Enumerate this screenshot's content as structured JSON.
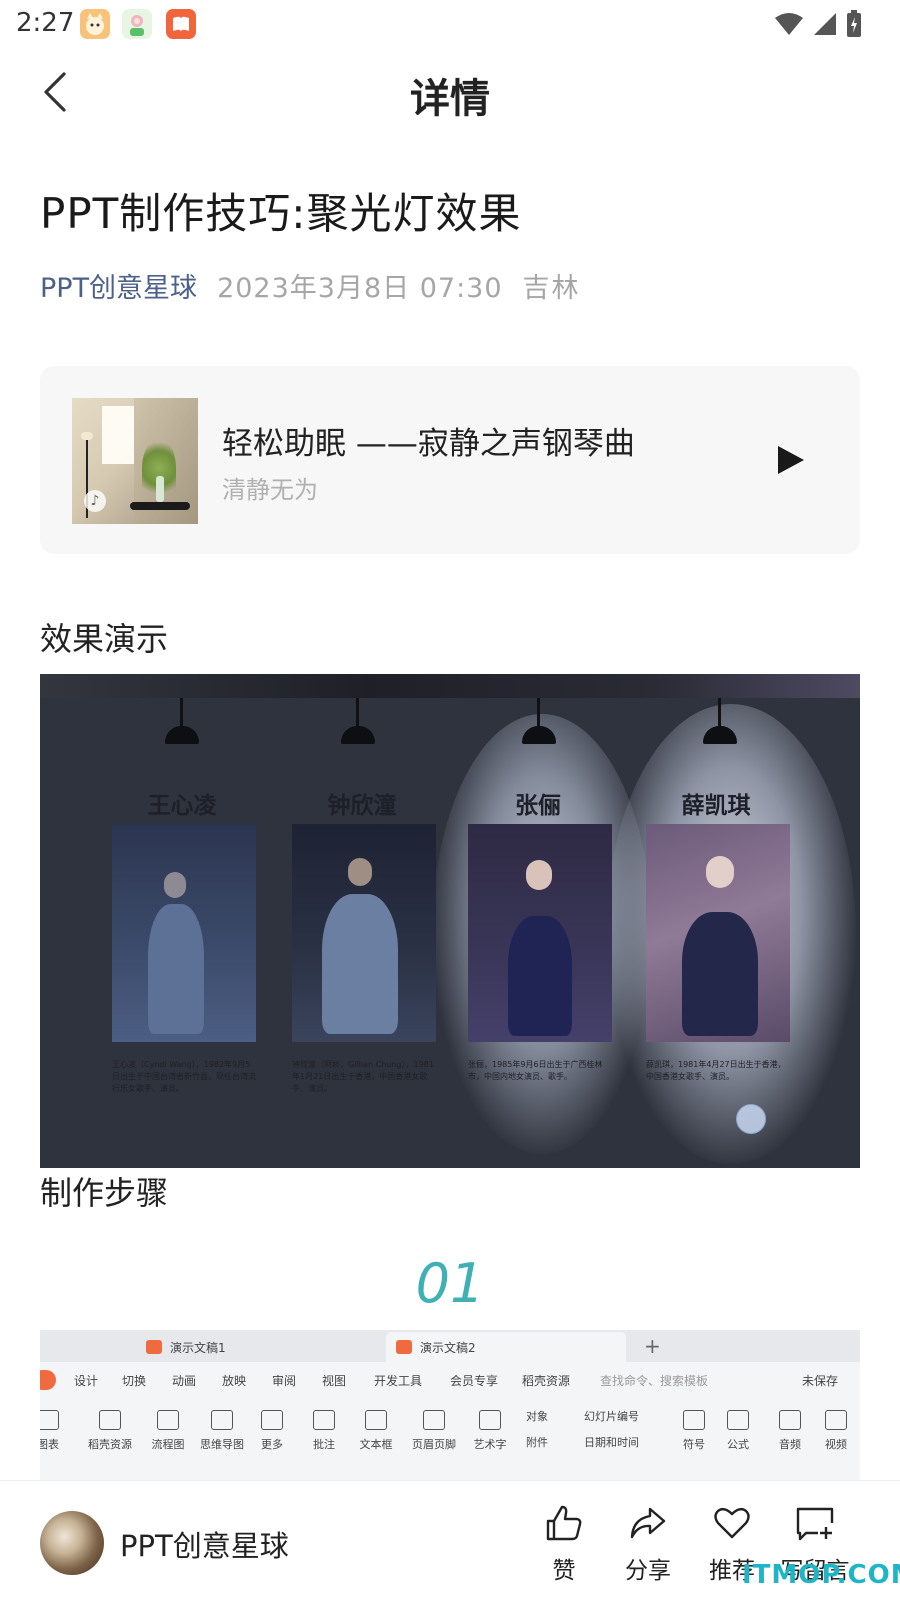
{
  "status_bar": {
    "time": "2:27"
  },
  "nav": {
    "title": "详情"
  },
  "article": {
    "title": "PPT制作技巧:聚光灯效果",
    "author": "PPT创意星球",
    "date": "2023年3月8日 07:30",
    "location": "吉林"
  },
  "music": {
    "title": "轻松助眠 ——寂静之声钢琴曲",
    "artist": "清静无为"
  },
  "sections": {
    "demo": "效果演示",
    "steps": "制作步骤"
  },
  "demo": {
    "people": [
      {
        "name": "王心凌",
        "caption": "王心凌（Cyndi Wang），1982年9月5日出生于中国台湾省新竹县，现任台湾流行乐女歌手、演员。"
      },
      {
        "name": "钟欣潼",
        "caption": "钟欣潼（阿娇，Gillian Chung），1981年1月21日出生于香港，中国香港女歌手、演员。"
      },
      {
        "name": "张俪",
        "caption": "张俪，1985年9月6日出生于广西桂林市，中国内地女演员、歌手。"
      },
      {
        "name": "薛凯琪",
        "caption": "薛凯琪，1981年4月27日出生于香港，中国香港女歌手、演员。"
      }
    ]
  },
  "step_number": "01",
  "office": {
    "tabs": [
      "演示文稿1",
      "演示文稿2"
    ],
    "menu": [
      "设计",
      "切换",
      "动画",
      "放映",
      "审阅",
      "视图",
      "开发工具",
      "会员专享",
      "稻壳资源",
      "查找命令、搜索模板",
      "未保存"
    ],
    "tools": [
      "图表",
      "稻壳资源",
      "流程图",
      "思维导图",
      "更多",
      "批注",
      "文本框",
      "页眉页脚",
      "艺术字",
      "对象",
      "幻灯片编号",
      "符号",
      "公式",
      "音频",
      "视频"
    ],
    "tools_small": [
      "附件",
      "日期和时间"
    ]
  },
  "bottom": {
    "account_name": "PPT创意星球",
    "actions": {
      "like": "赞",
      "share": "分享",
      "recommend": "推荐",
      "comment": "写留言"
    }
  },
  "watermark": "ITMOP.COM",
  "colors": {
    "accent_author": "#4b6189",
    "step_number": "#3fb0b3"
  }
}
